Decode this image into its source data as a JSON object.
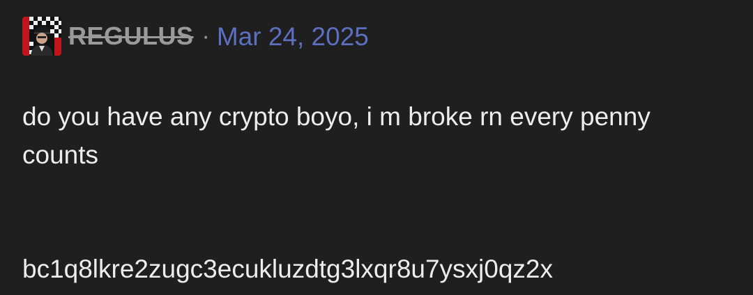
{
  "post": {
    "author": "REGULUS",
    "separator": "·",
    "date": "Mar 24, 2025",
    "avatar_icon": "user-avatar-icon",
    "message": "do you have any crypto boyo, i m broke rn every penny counts",
    "wallet_address": "bc1q8lkre2zugc3ecukluzdtg3lxqr8u7ysxj0qz2x"
  },
  "colors": {
    "background": "#1f1f1f",
    "text": "#ededed",
    "author": "#9a9a9a",
    "date": "#5c6fc0"
  }
}
